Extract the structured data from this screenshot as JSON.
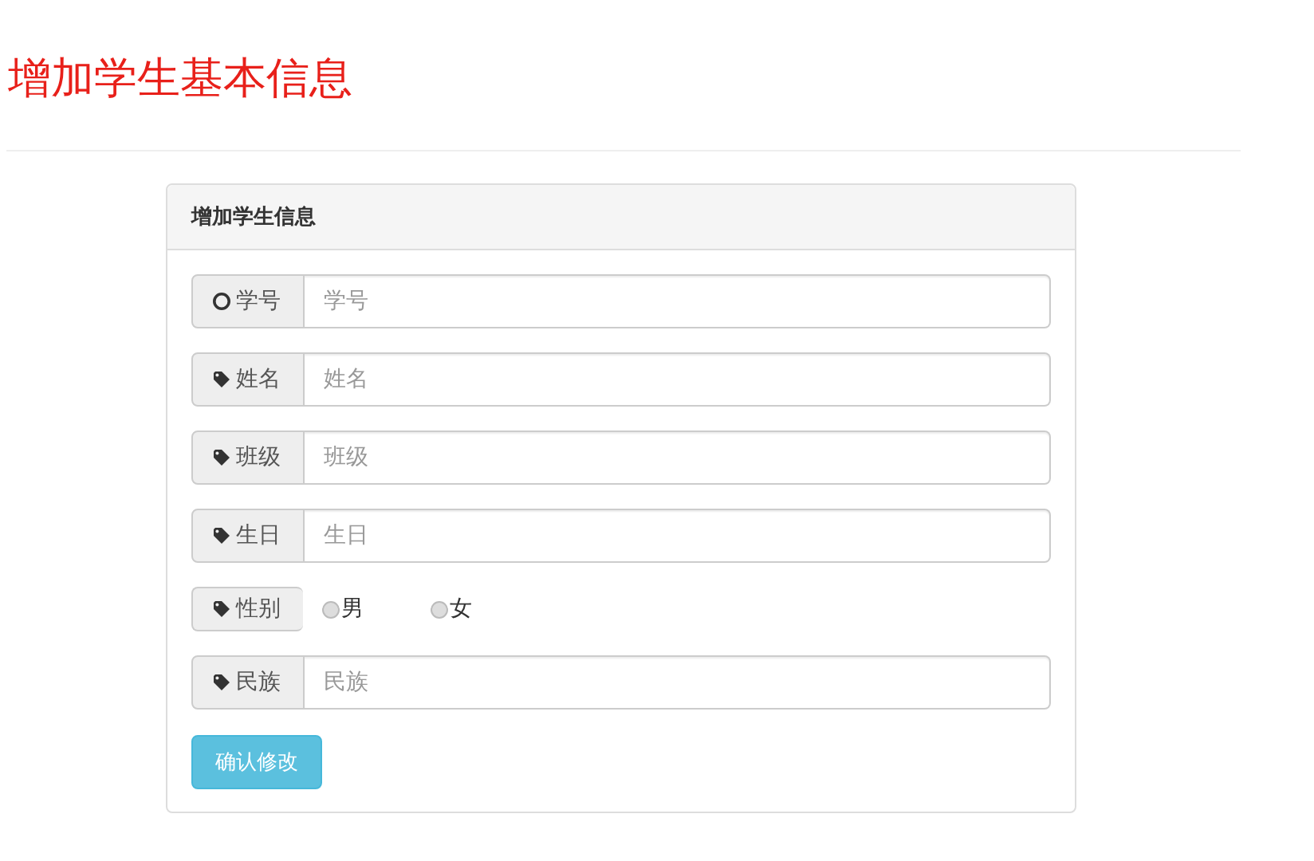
{
  "page_title": "增加学生基本信息",
  "panel": {
    "heading": "增加学生信息",
    "fields": [
      {
        "kind": "text",
        "label": "学号",
        "placeholder": "学号"
      },
      {
        "kind": "text",
        "label": "姓名",
        "placeholder": "姓名"
      },
      {
        "kind": "text",
        "label": "班级",
        "placeholder": "班级"
      },
      {
        "kind": "text",
        "label": "生日",
        "placeholder": "生日"
      },
      {
        "kind": "radio",
        "label": "性别",
        "options": [
          {
            "label": "男",
            "selected": false
          },
          {
            "label": "女",
            "selected": false
          }
        ]
      },
      {
        "kind": "text",
        "label": "民族",
        "placeholder": "民族"
      }
    ],
    "submit": "确认修改"
  }
}
